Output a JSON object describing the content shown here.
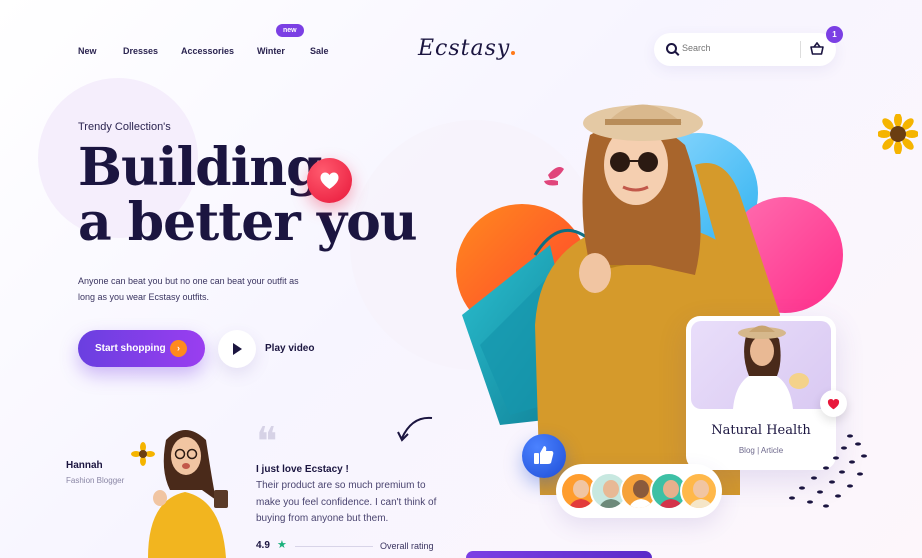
{
  "nav": {
    "items": [
      {
        "label": "New"
      },
      {
        "label": "Dresses"
      },
      {
        "label": "Accessories"
      },
      {
        "label": "Winter"
      },
      {
        "label": "Sale"
      }
    ],
    "winter_badge": "new"
  },
  "brand": {
    "name": "Ecstasy",
    "dot_color": "#ff7a1a"
  },
  "search": {
    "placeholder": "Search"
  },
  "cart": {
    "count": "1",
    "icon": "basket-icon"
  },
  "hero": {
    "eyebrow": "Trendy Collection's",
    "headline_line1": "Building",
    "headline_line2": "a better you",
    "description": "Anyone can beat you but no one can beat your outfit as long as you wear Ecstasy outfits.",
    "primary_cta": "Start shopping",
    "secondary_cta": "Play video"
  },
  "testimonial": {
    "name": "Hannah",
    "role": "Fashion Blogger",
    "title": "I just love Ecstacy !",
    "text": "Their product are so much premium to make you feel confidence. I can't think of buying from anyone but them.",
    "rating": "4.9",
    "rating_label": "Overall rating"
  },
  "article_card": {
    "title": "Natural Health",
    "tags": "Blog | Article"
  },
  "colors": {
    "accent": "#7b3fe4",
    "cta_arrow": "#ff8a1e",
    "heart": "#e8173a",
    "like": "#1f4fd8",
    "star": "#19b07b"
  }
}
